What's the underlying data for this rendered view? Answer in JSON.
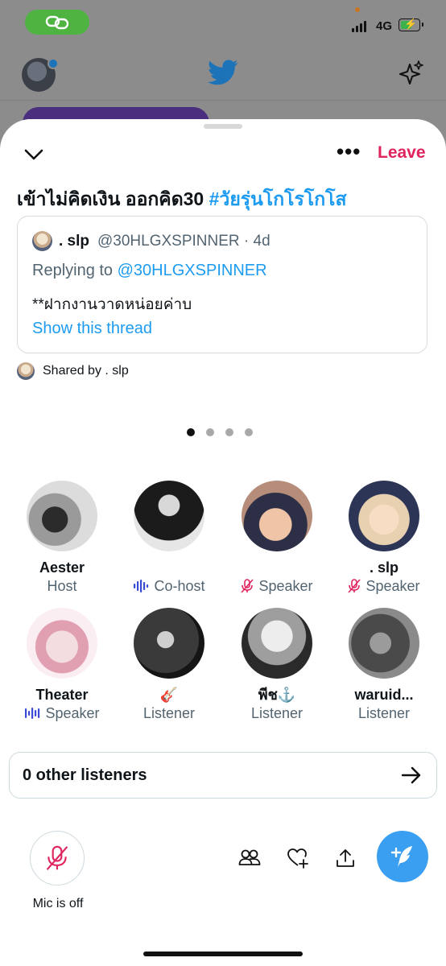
{
  "status_bar": {
    "network": "4G",
    "signal_bars": 4,
    "battery_level": 0.55
  },
  "space": {
    "title_text": "เข้าไม่คิดเงิน ออกคิด30 ",
    "title_hashtag": "#วัยรุ่นโกโรโกโส",
    "leave_label": "Leave",
    "more_label": "•••"
  },
  "shared_tweet": {
    "author_name": ". slp",
    "author_handle": "@30HLGXSPINNER",
    "time": "· 4d",
    "replying_prefix": "Replying to ",
    "replying_to": "@30HLGXSPINNER",
    "body": "**ฝากงานวาดหน่อยค่าบ",
    "show_thread": "Show this thread"
  },
  "shared_by": "Shared by . slp",
  "pager": {
    "count": 4,
    "active": 0
  },
  "participants": [
    {
      "name": "Aester",
      "role": "Host",
      "role_icon": "none"
    },
    {
      "name": "",
      "role": "Co-host",
      "role_icon": "speaking-wave-icon"
    },
    {
      "name": "",
      "role": "Speaker",
      "role_icon": "mic-off-icon"
    },
    {
      "name": ". slp",
      "role": "Speaker",
      "role_icon": "mic-off-icon"
    },
    {
      "name": "Theater",
      "role": "Speaker",
      "role_icon": "speaking-wave-icon"
    },
    {
      "name": "🎸",
      "role": "Listener",
      "role_icon": "none"
    },
    {
      "name": "พีช⚓️",
      "role": "Listener",
      "role_icon": "none"
    },
    {
      "name": "waruid...",
      "role": "Listener",
      "role_icon": "none"
    }
  ],
  "listeners": {
    "label": "0 other listeners"
  },
  "mic": {
    "label": "Mic is off"
  },
  "colors": {
    "accent": "#1d9bf0",
    "leave": "#e0245e",
    "mic_off": "#e0245e",
    "wave": "#3b4ad6",
    "compose": "#3a9ff0"
  }
}
